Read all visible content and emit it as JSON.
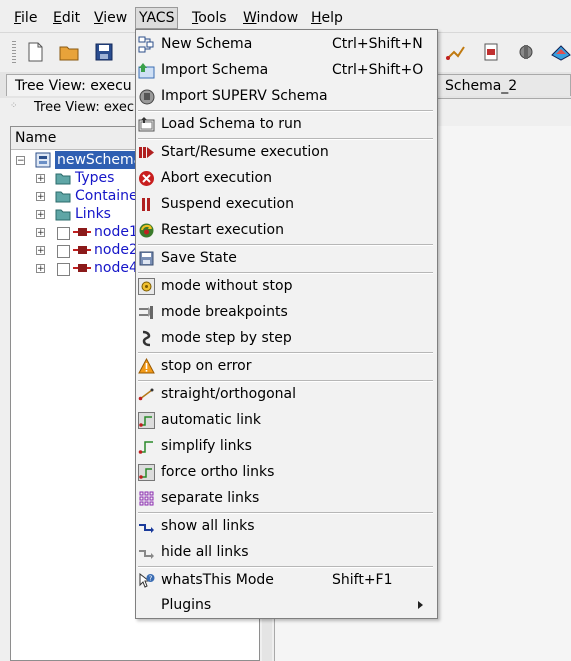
{
  "menubar": {
    "items": [
      {
        "label": "File",
        "key": "F",
        "rest": "ile"
      },
      {
        "label": "Edit",
        "key": "E",
        "rest": "dit"
      },
      {
        "label": "View",
        "key": "V",
        "rest": "iew"
      },
      {
        "label": "YACS",
        "key": "",
        "rest": "YACS"
      },
      {
        "label": "Tools",
        "key": "T",
        "rest": "ools"
      },
      {
        "label": "Window",
        "key": "W",
        "rest": "indow"
      },
      {
        "label": "Help",
        "key": "H",
        "rest": "elp"
      }
    ]
  },
  "tabs": {
    "tree_tab": "Tree View: execu",
    "schema_tab": "Schema_2",
    "sub_label": "Tree View: execu"
  },
  "tree": {
    "header": "Name",
    "root": "newSchema",
    "items": [
      "Types",
      "Containe",
      "Links",
      "node1",
      "node2",
      "node4"
    ]
  },
  "yacs_menu": {
    "items": [
      {
        "label": "New Schema",
        "shortcut": "Ctrl+Shift+N",
        "icon": "new-schema-icon"
      },
      {
        "label": "Import Schema",
        "shortcut": "Ctrl+Shift+O",
        "icon": "import-schema-icon"
      },
      {
        "label": "Import SUPERV Schema",
        "shortcut": "",
        "icon": "import-superv-icon"
      },
      {
        "label": "Load Schema to run",
        "shortcut": "",
        "icon": "load-schema-icon"
      },
      {
        "label": "Start/Resume execution",
        "shortcut": "",
        "icon": "start-icon"
      },
      {
        "label": "Abort execution",
        "shortcut": "",
        "icon": "abort-icon"
      },
      {
        "label": "Suspend execution",
        "shortcut": "",
        "icon": "suspend-icon"
      },
      {
        "label": "Restart execution",
        "shortcut": "",
        "icon": "restart-icon"
      },
      {
        "label": "Save State",
        "shortcut": "",
        "icon": "save-state-icon"
      },
      {
        "label": "mode without stop",
        "shortcut": "",
        "icon": "mode-without-stop-icon"
      },
      {
        "label": "mode breakpoints",
        "shortcut": "",
        "icon": "mode-breakpoints-icon"
      },
      {
        "label": "mode step by step",
        "shortcut": "",
        "icon": "mode-step-icon"
      },
      {
        "label": "stop on error",
        "shortcut": "",
        "icon": "warning-icon"
      },
      {
        "label": "straight/orthogonal",
        "shortcut": "",
        "icon": "straight-orthogonal-icon"
      },
      {
        "label": "automatic link",
        "shortcut": "",
        "icon": "automatic-link-icon"
      },
      {
        "label": "simplify links",
        "shortcut": "",
        "icon": "simplify-links-icon"
      },
      {
        "label": "force ortho links",
        "shortcut": "",
        "icon": "force-ortho-icon"
      },
      {
        "label": "separate links",
        "shortcut": "",
        "icon": "separate-links-icon"
      },
      {
        "label": "show all links",
        "shortcut": "",
        "icon": "show-links-icon"
      },
      {
        "label": "hide all links",
        "shortcut": "",
        "icon": "hide-links-icon"
      },
      {
        "label": "whatsThis Mode",
        "shortcut": "Shift+F1",
        "icon": "whatsthis-icon"
      },
      {
        "label": "Plugins",
        "shortcut": "",
        "icon": ""
      }
    ]
  },
  "colors": {
    "accent": "#2f5fb2",
    "tree_text": "#1515c8",
    "menu_bg": "#f2f2f2"
  }
}
